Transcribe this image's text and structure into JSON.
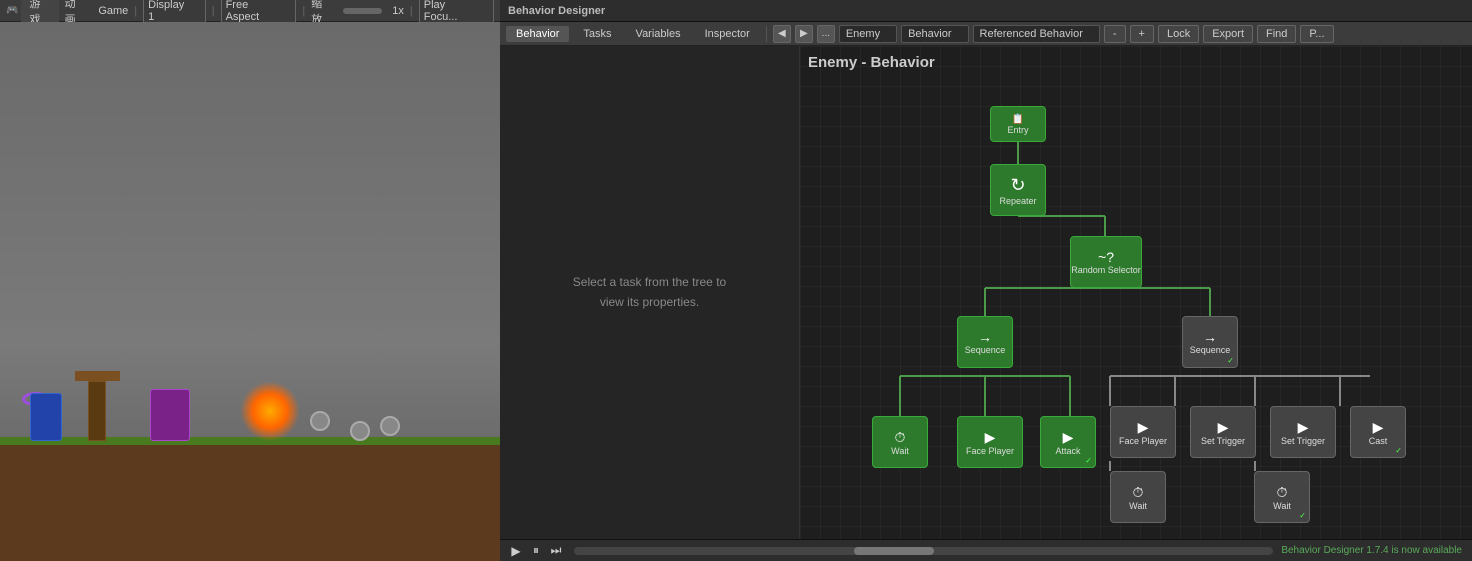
{
  "game": {
    "tabs": [
      "游戏",
      "动画"
    ],
    "active_tab": "游戏",
    "toolbar": {
      "game_label": "Game",
      "display": "Display 1",
      "aspect": "Free Aspect",
      "scale": "缩放",
      "zoom": "1x",
      "play_focus": "Play Focu..."
    }
  },
  "bd": {
    "title": "Behavior Designer",
    "menu": {
      "behavior": "Behavior",
      "tasks": "Tasks",
      "variables": "Variables",
      "inspector": "Inspector"
    },
    "toolbar": {
      "nav_back": "◀",
      "nav_forward": "▶",
      "ellipsis": "...",
      "entity": "Enemy",
      "behavior": "Behavior",
      "referenced": "Referenced Behavior",
      "minus": "-",
      "plus": "+",
      "lock": "Lock",
      "export": "Export",
      "find": "Find",
      "p": "P..."
    },
    "canvas_title": "Enemy - Behavior",
    "inspector_hint_line1": "Select a task from the tree to",
    "inspector_hint_line2": "view its properties.",
    "nodes": {
      "entry": "Entry",
      "repeater": "Repeater",
      "random_selector": "Random Selector",
      "sequence1": "Sequence",
      "sequence2": "Sequence",
      "wait1": "Wait",
      "face_player": "Face Player",
      "attack": "Attack",
      "face_player2": "Face Player",
      "set_trigger1": "Set Trigger",
      "set_trigger2": "Set Trigger",
      "cast": "Cast",
      "wait2": "Wait",
      "wait3": "Wait"
    },
    "status": "Behavior Designer 1.7.4 is now available"
  }
}
